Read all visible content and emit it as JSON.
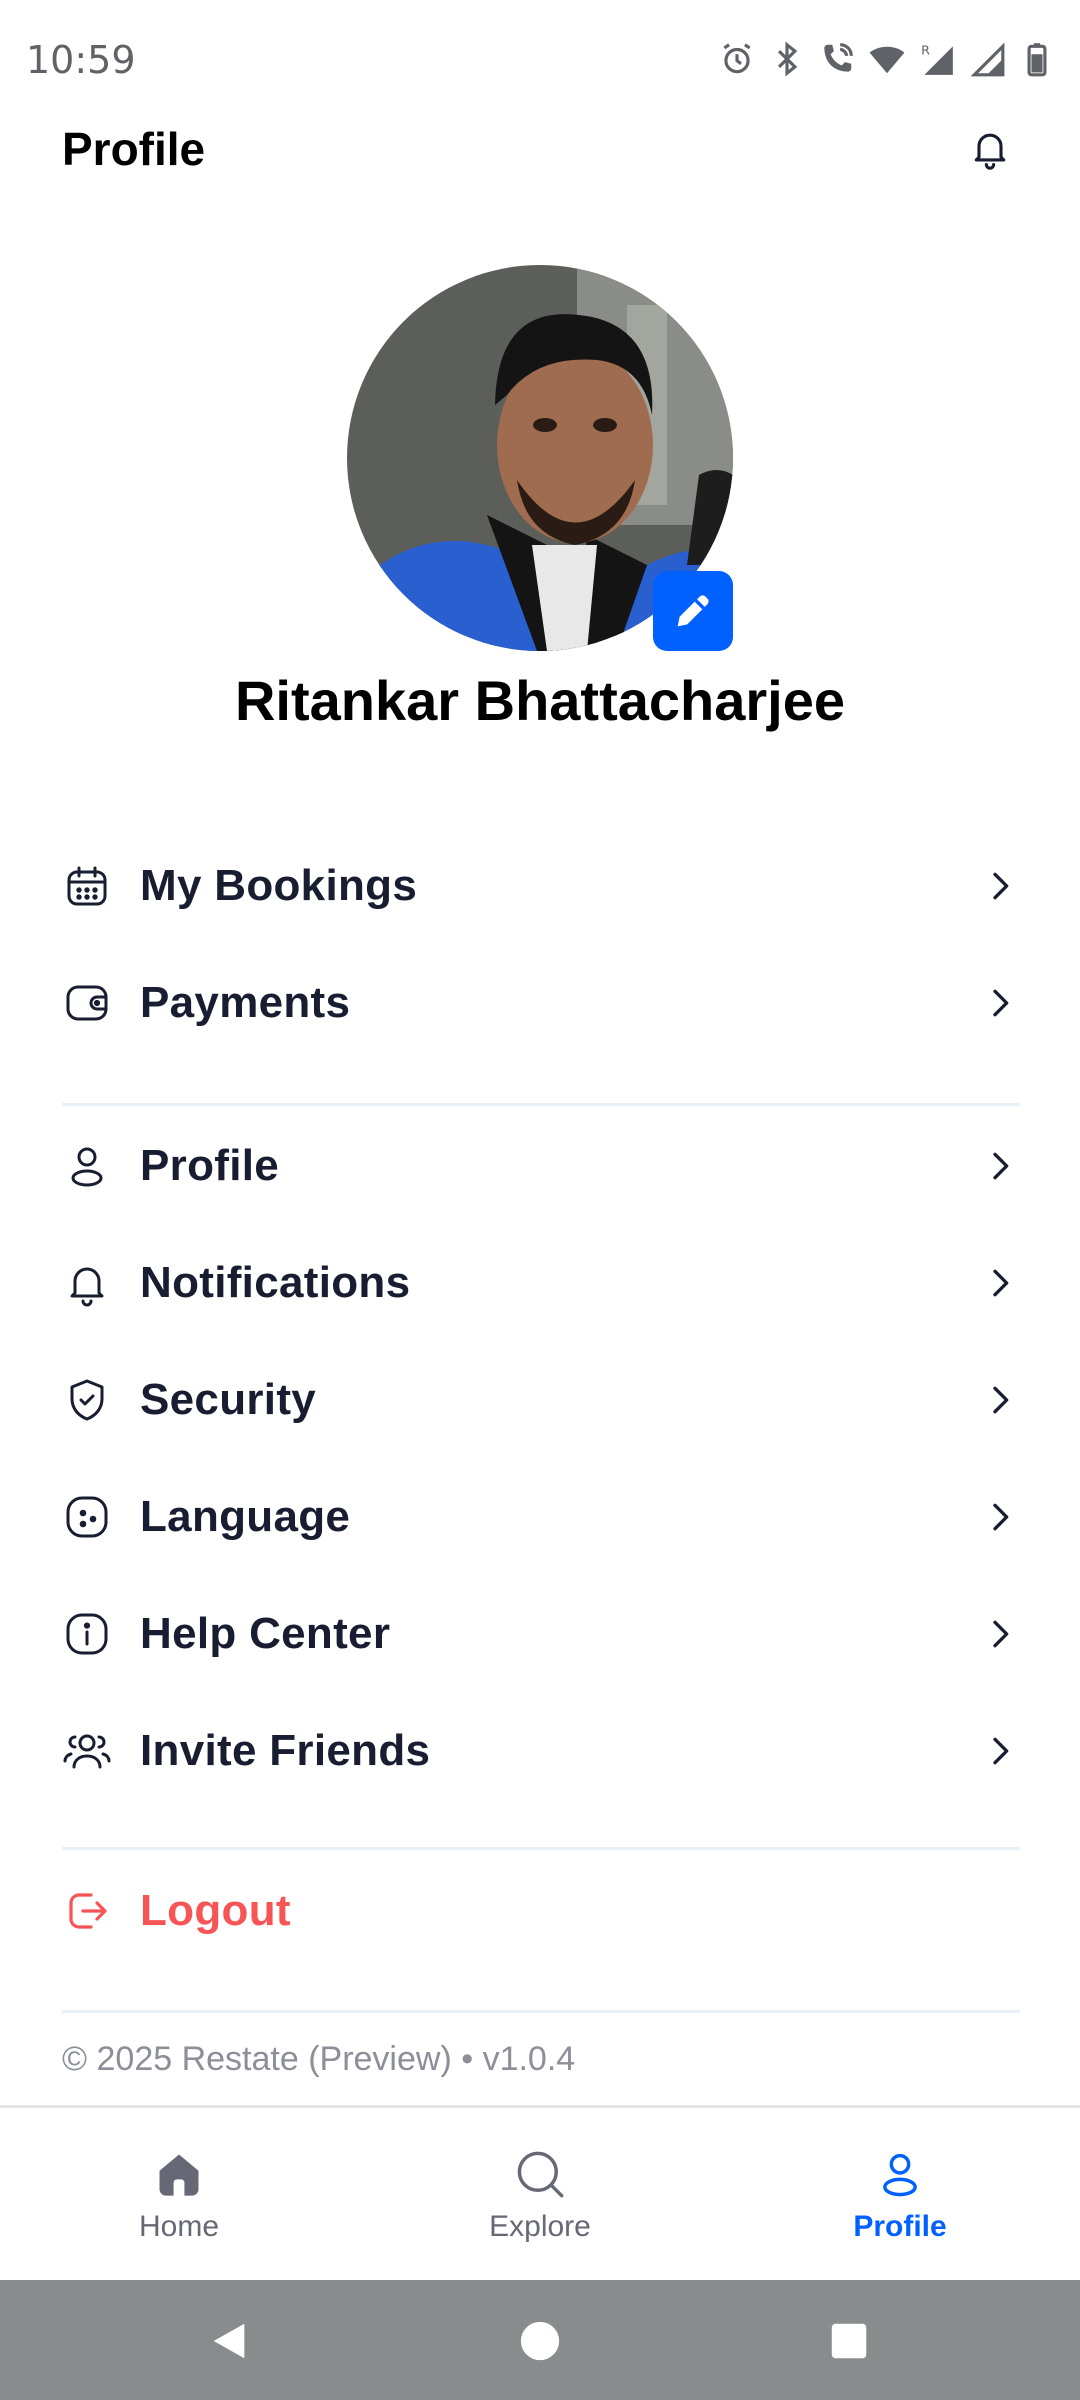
{
  "status_bar": {
    "time": "10:59",
    "icons": [
      "alarm-icon",
      "bluetooth-icon",
      "wifi-call-icon",
      "wifi-icon",
      "signal-r-icon",
      "signal-icon",
      "battery-icon"
    ]
  },
  "header": {
    "title": "Profile",
    "bell_icon": "bell-icon"
  },
  "profile": {
    "name": "Ritankar Bhattacharjee",
    "edit_icon": "pencil-icon"
  },
  "menu_primary": [
    {
      "label": "My Bookings",
      "icon": "calendar-icon"
    },
    {
      "label": "Payments",
      "icon": "wallet-icon"
    }
  ],
  "menu_settings": [
    {
      "label": "Profile",
      "icon": "person-icon"
    },
    {
      "label": "Notifications",
      "icon": "bell-icon"
    },
    {
      "label": "Security",
      "icon": "shield-icon"
    },
    {
      "label": "Language",
      "icon": "language-icon"
    },
    {
      "label": "Help Center",
      "icon": "info-icon"
    },
    {
      "label": "Invite Friends",
      "icon": "people-icon"
    }
  ],
  "logout": {
    "label": "Logout",
    "icon": "logout-icon",
    "color": "#f75555"
  },
  "footer": "© 2025 Restate (Preview) • v1.0.4",
  "tabs": [
    {
      "label": "Home",
      "icon": "home-icon",
      "active": false
    },
    {
      "label": "Explore",
      "icon": "search-icon",
      "active": false
    },
    {
      "label": "Profile",
      "icon": "person-icon",
      "active": true
    }
  ],
  "colors": {
    "accent": "#0061ff",
    "danger": "#f75555",
    "text_primary": "#191d31",
    "text_muted": "#8c8e98"
  }
}
